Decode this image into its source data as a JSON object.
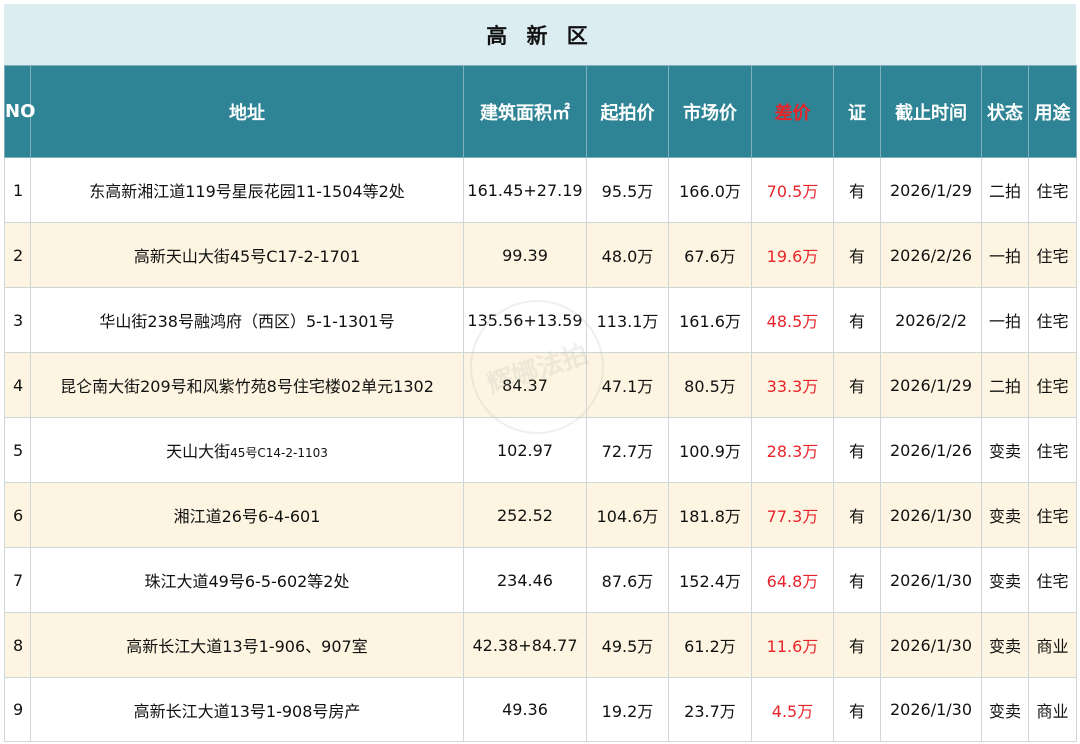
{
  "title": "高 新 区",
  "headers": {
    "no": "NO",
    "address": "地址",
    "area": "建筑面积㎡",
    "start_price": "起拍价",
    "market_price": "市场价",
    "diff": "差价",
    "cert": "证",
    "deadline": "截止时间",
    "status": "状态",
    "usage": "用途"
  },
  "colors": {
    "header_bg": "#2e8494",
    "title_bg": "#dcedf2",
    "alt_row": "#fdf5e1",
    "diff_text": "#e8242a"
  },
  "watermark": "辉娜法拍",
  "rows": [
    {
      "no": "1",
      "address": "东高新湘江道119号星辰花园11-1504等2处",
      "area": "161.45+27.19",
      "start_price": "95.5万",
      "market_price": "166.0万",
      "diff": "70.5万",
      "cert": "有",
      "deadline": "2026/1/29",
      "status": "二拍",
      "usage": "住宅"
    },
    {
      "no": "2",
      "address": "高新天山大街45号C17-2-1701",
      "area": "99.39",
      "start_price": "48.0万",
      "market_price": "67.6万",
      "diff": "19.6万",
      "cert": "有",
      "deadline": "2026/2/26",
      "status": "一拍",
      "usage": "住宅"
    },
    {
      "no": "3",
      "address": "华山街238号融鸿府（西区）5-1-1301号",
      "area": "135.56+13.59",
      "start_price": "113.1万",
      "market_price": "161.6万",
      "diff": "48.5万",
      "cert": "有",
      "deadline": "2026/2/2",
      "status": "一拍",
      "usage": "住宅"
    },
    {
      "no": "4",
      "address": "昆仑南大街209号和风紫竹苑8号住宅楼02单元1302",
      "area": "84.37",
      "start_price": "47.1万",
      "market_price": "80.5万",
      "diff": "33.3万",
      "cert": "有",
      "deadline": "2026/1/29",
      "status": "二拍",
      "usage": "住宅"
    },
    {
      "no": "5",
      "address": "天山大街",
      "address_small": "45号C14-2-1103",
      "area": "102.97",
      "start_price": "72.7万",
      "market_price": "100.9万",
      "diff": "28.3万",
      "cert": "有",
      "deadline": "2026/1/26",
      "status": "变卖",
      "usage": "住宅"
    },
    {
      "no": "6",
      "address": "湘江道26号6-4-601",
      "area": "252.52",
      "start_price": "104.6万",
      "market_price": "181.8万",
      "diff": "77.3万",
      "cert": "有",
      "deadline": "2026/1/30",
      "status": "变卖",
      "usage": "住宅"
    },
    {
      "no": "7",
      "address": "珠江大道49号6-5-602等2处",
      "area": "234.46",
      "start_price": "87.6万",
      "market_price": "152.4万",
      "diff": "64.8万",
      "cert": "有",
      "deadline": "2026/1/30",
      "status": "变卖",
      "usage": "住宅"
    },
    {
      "no": "8",
      "address": "高新长江大道13号1-906、907室",
      "area": "42.38+84.77",
      "start_price": "49.5万",
      "market_price": "61.2万",
      "diff": "11.6万",
      "cert": "有",
      "deadline": "2026/1/30",
      "status": "变卖",
      "usage": "商业"
    },
    {
      "no": "9",
      "address": "高新长江大道13号1-908号房产",
      "area": "49.36",
      "start_price": "19.2万",
      "market_price": "23.7万",
      "diff": "4.5万",
      "cert": "有",
      "deadline": "2026/1/30",
      "status": "变卖",
      "usage": "商业"
    }
  ]
}
